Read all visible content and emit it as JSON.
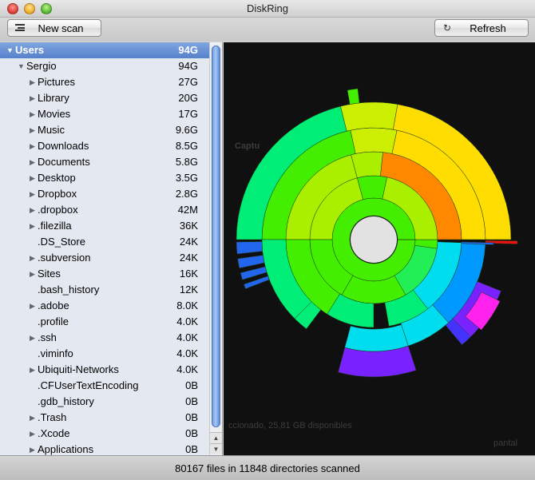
{
  "window": {
    "title": "DiskRing"
  },
  "toolbar": {
    "new_scan_label": "New scan",
    "refresh_label": "Refresh"
  },
  "tree": {
    "root": {
      "name": "Users",
      "size": "94G"
    },
    "user": {
      "name": "Sergio",
      "size": "94G"
    },
    "items": [
      {
        "name": "Pictures",
        "size": "27G",
        "expandable": true
      },
      {
        "name": "Library",
        "size": "20G",
        "expandable": true
      },
      {
        "name": "Movies",
        "size": "17G",
        "expandable": true
      },
      {
        "name": "Music",
        "size": "9.6G",
        "expandable": true
      },
      {
        "name": "Downloads",
        "size": "8.5G",
        "expandable": true
      },
      {
        "name": "Documents",
        "size": "5.8G",
        "expandable": true
      },
      {
        "name": "Desktop",
        "size": "3.5G",
        "expandable": true
      },
      {
        "name": "Dropbox",
        "size": "2.8G",
        "expandable": true
      },
      {
        "name": ".dropbox",
        "size": "42M",
        "expandable": true
      },
      {
        "name": ".filezilla",
        "size": "36K",
        "expandable": true
      },
      {
        "name": ".DS_Store",
        "size": "24K",
        "expandable": false
      },
      {
        "name": ".subversion",
        "size": "24K",
        "expandable": true
      },
      {
        "name": "Sites",
        "size": "16K",
        "expandable": true
      },
      {
        "name": ".bash_history",
        "size": "12K",
        "expandable": false
      },
      {
        "name": ".adobe",
        "size": "8.0K",
        "expandable": true
      },
      {
        "name": ".profile",
        "size": "4.0K",
        "expandable": false
      },
      {
        "name": ".ssh",
        "size": "4.0K",
        "expandable": true
      },
      {
        "name": ".viminfo",
        "size": "4.0K",
        "expandable": false
      },
      {
        "name": "Ubiquiti-Networks",
        "size": "4.0K",
        "expandable": true
      },
      {
        "name": ".CFUserTextEncoding",
        "size": "0B",
        "expandable": false
      },
      {
        "name": ".gdb_history",
        "size": "0B",
        "expandable": false
      },
      {
        "name": ".Trash",
        "size": "0B",
        "expandable": true
      },
      {
        "name": ".Xcode",
        "size": "0B",
        "expandable": true
      },
      {
        "name": "Applications",
        "size": "0B",
        "expandable": true
      }
    ]
  },
  "background_text": {
    "capture": "Captu",
    "free_space": "ccionado, 25,81 GB disponibles",
    "pantalla": "pantal"
  },
  "status": {
    "text": "80167 files in 11848 directories scanned"
  },
  "colors": {
    "selection": "#5681cc",
    "ring_green": "#44ee00",
    "ring_yellow_green": "#aaee00",
    "ring_yellow": "#ffdd00",
    "ring_orange": "#ff8800",
    "ring_spring": "#00ee77",
    "ring_cyan": "#00ddee",
    "ring_blue": "#2266ee",
    "ring_violet": "#7722ff",
    "ring_magenta": "#ff22ee",
    "ring_red": "#ee1111",
    "center": "#e2e2e2"
  },
  "icons": {
    "new_scan": "menu-lines-icon",
    "refresh": "refresh-icon",
    "expanded": "disclosure-down-icon",
    "collapsed": "disclosure-right-icon"
  }
}
